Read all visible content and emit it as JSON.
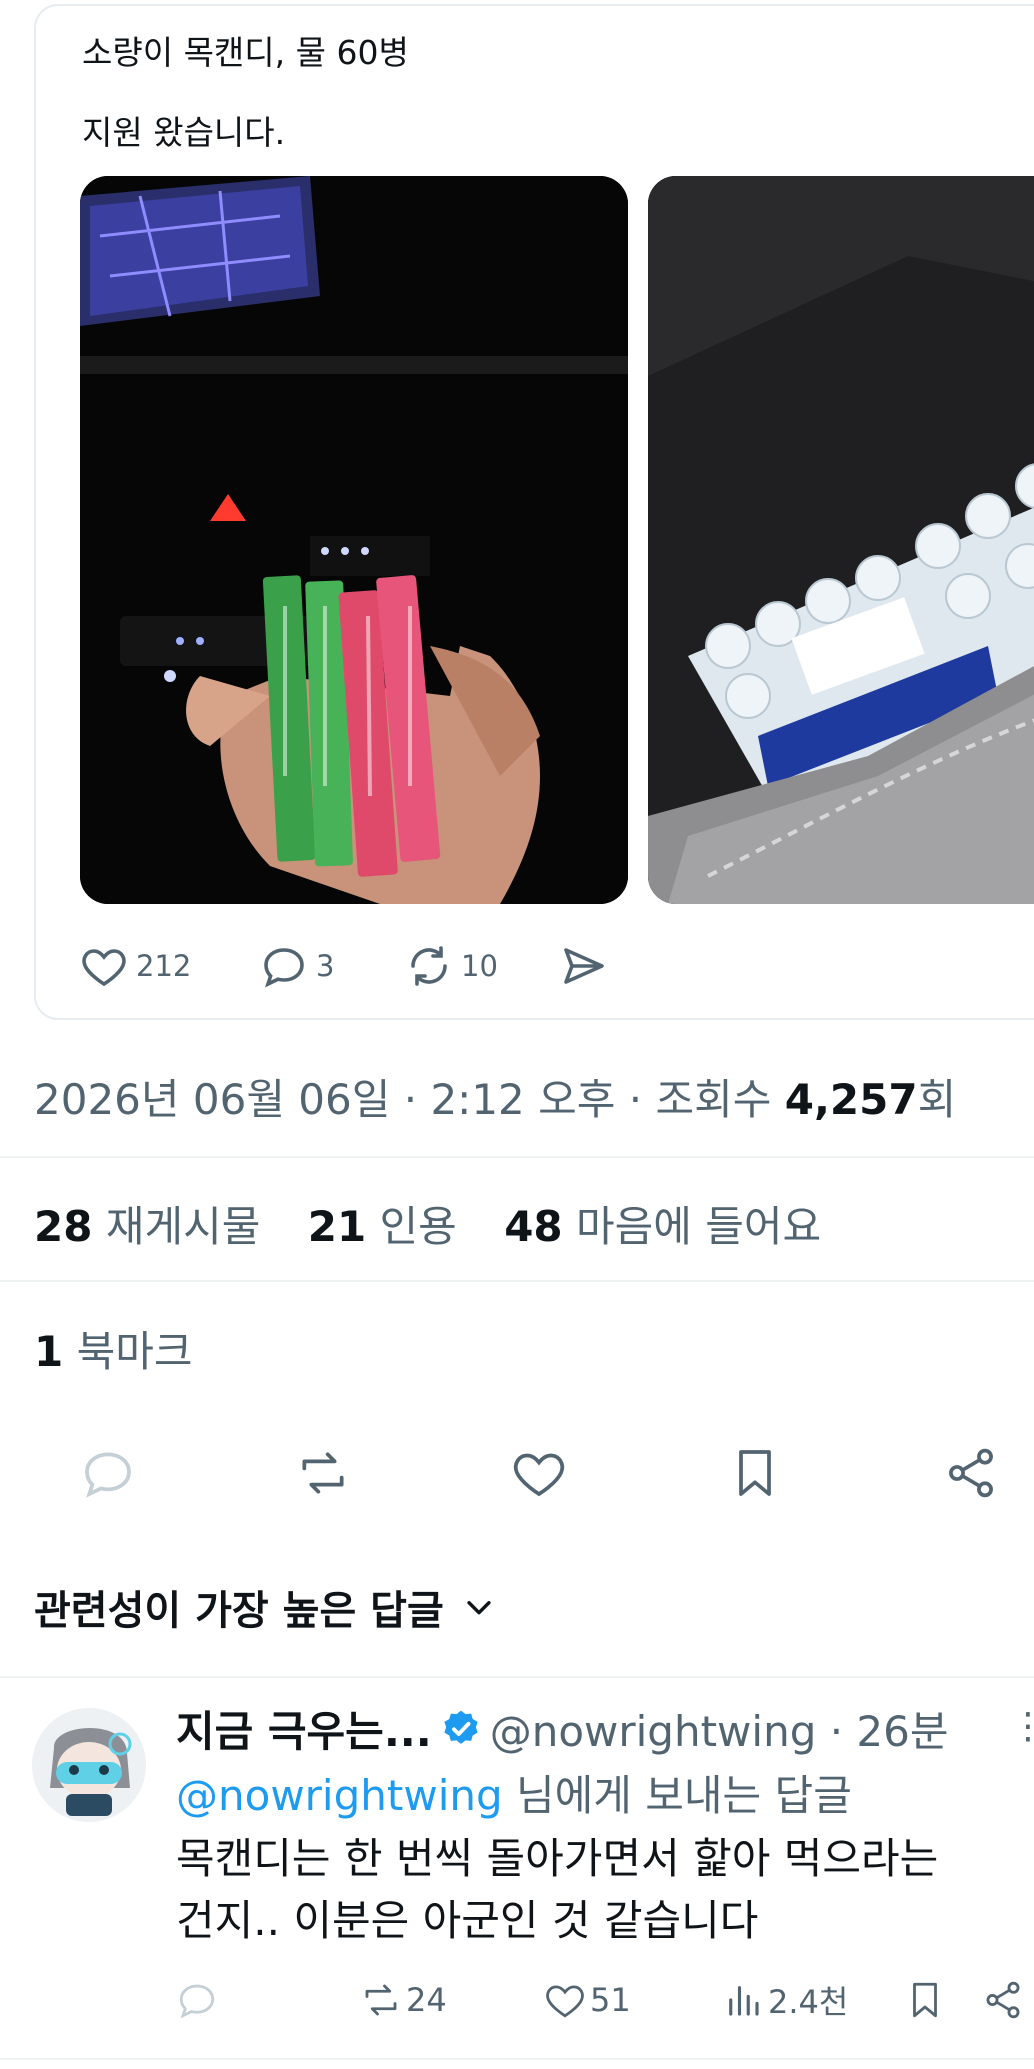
{
  "post": {
    "lines": [
      "소량이 목캔디, 물 60병",
      "지원 왔습니다."
    ],
    "photos": [
      {
        "alt": "hand-holding-throat-candy-packs"
      },
      {
        "alt": "water-bottle-packs-in-car-trunk"
      }
    ],
    "actions": {
      "likes": "212",
      "replies": "3",
      "reposts": "10"
    }
  },
  "meta": {
    "timestamp": "2026년 06월 06일 · 2:12 오후 · 조회수 ",
    "views": "4,257",
    "views_suffix": "회"
  },
  "stats": {
    "reposts_count": "28",
    "reposts_label": "재게시물",
    "quotes_count": "21",
    "quotes_label": "인용",
    "likes_count": "48",
    "likes_label": "마음에 들어요",
    "bookmarks_count": "1",
    "bookmarks_label": "북마크"
  },
  "action_bar": {
    "icons": [
      "reply-icon",
      "repost-icon",
      "like-icon",
      "bookmark-icon",
      "share-icon"
    ]
  },
  "sort": {
    "label": "관련성이 가장 높은 답글"
  },
  "reply": {
    "name": "지금 극우는...",
    "handle": "@nowrightwing · 26분",
    "more": "⋮",
    "reply_to_mention": "@nowrightwing",
    "reply_to_suffix": " 님에게 보내는 답글",
    "body_line1": "목캔디는 한 번씩 돌아가면서 핥아 먹으라는",
    "body_line2": "건지.. 이분은 아군인 것 같습니다",
    "actions": {
      "reposts": "24",
      "likes": "51",
      "views": "2.4천"
    }
  },
  "colors": {
    "accent": "#1d9bf0",
    "text": "#0f1419",
    "muted": "#536471",
    "divider": "#eff3f4"
  }
}
